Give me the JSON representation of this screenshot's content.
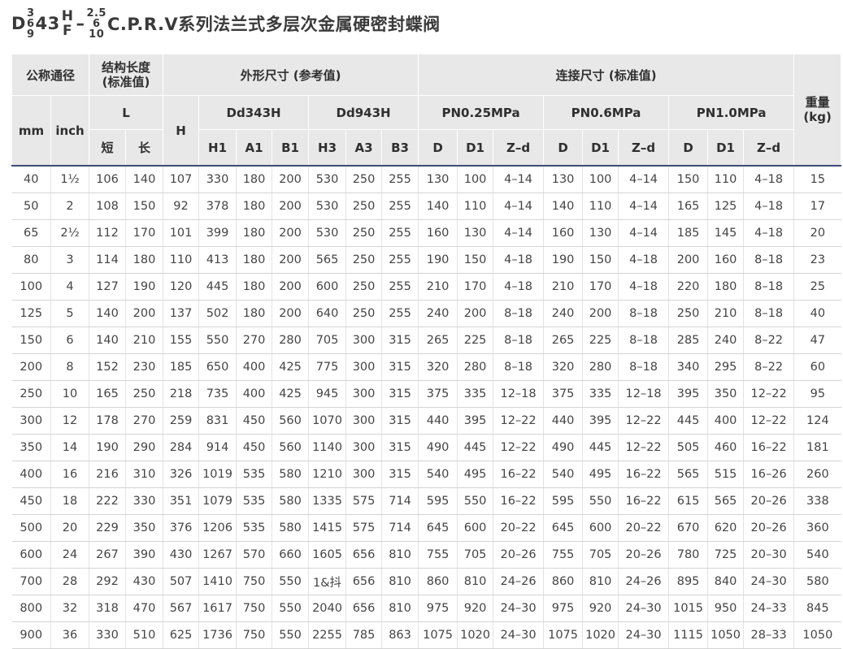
{
  "title": {
    "prefix": "D",
    "frac_top": "3",
    "frac_mid": "6",
    "frac_bot": "9",
    "mid_text": "43",
    "hf_top": "H",
    "hf_bot": "F",
    "dash": "–",
    "p_top": "2.5",
    "p_mid": "6",
    "p_bot": "10",
    "suffix": "C.P.R.V系列法兰式多层次金属硬密封蝶阀"
  },
  "headers": {
    "nominal": "公称通径",
    "structure_length": "结构长度\n(标准值)",
    "outline": "外形尺寸 (参考值)",
    "connection": "连接尺寸 (标准值)",
    "weight": "重量\n(kg)",
    "mm": "mm",
    "inch": "inch",
    "L": "L",
    "H": "H",
    "dd343h": "Dd343H",
    "dd943h": "Dd943H",
    "pn025": "PN0.25MPa",
    "pn06": "PN0.6MPa",
    "pn10": "PN1.0MPa",
    "short": "短",
    "long": "长",
    "H1": "H1",
    "A1": "A1",
    "B1": "B1",
    "H3": "H3",
    "A3": "A3",
    "B3": "B3",
    "D": "D",
    "D1": "D1",
    "Zd": "Z–d"
  },
  "rows": [
    [
      "40",
      "1½",
      "106",
      "140",
      "107",
      "330",
      "180",
      "200",
      "530",
      "250",
      "255",
      "130",
      "100",
      "4–14",
      "130",
      "100",
      "4–14",
      "150",
      "110",
      "4–18",
      "15"
    ],
    [
      "50",
      "2",
      "108",
      "150",
      "92",
      "378",
      "180",
      "200",
      "530",
      "250",
      "255",
      "140",
      "110",
      "4–14",
      "140",
      "110",
      "4–14",
      "165",
      "125",
      "4–18",
      "17"
    ],
    [
      "65",
      "2½",
      "112",
      "170",
      "101",
      "399",
      "180",
      "200",
      "530",
      "250",
      "255",
      "160",
      "130",
      "4–14",
      "160",
      "130",
      "4–14",
      "185",
      "145",
      "4–18",
      "20"
    ],
    [
      "80",
      "3",
      "114",
      "180",
      "110",
      "413",
      "180",
      "200",
      "565",
      "250",
      "255",
      "190",
      "150",
      "4–18",
      "190",
      "150",
      "4–18",
      "200",
      "160",
      "8–18",
      "23"
    ],
    [
      "100",
      "4",
      "127",
      "190",
      "120",
      "445",
      "180",
      "200",
      "600",
      "250",
      "255",
      "210",
      "170",
      "4–18",
      "210",
      "170",
      "4–18",
      "220",
      "180",
      "8–18",
      "25"
    ],
    [
      "125",
      "5",
      "140",
      "200",
      "137",
      "502",
      "180",
      "200",
      "640",
      "250",
      "255",
      "240",
      "200",
      "8–18",
      "240",
      "200",
      "8–18",
      "250",
      "210",
      "8–18",
      "40"
    ],
    [
      "150",
      "6",
      "140",
      "210",
      "155",
      "550",
      "270",
      "280",
      "705",
      "300",
      "315",
      "265",
      "225",
      "8–18",
      "265",
      "225",
      "8–18",
      "285",
      "240",
      "8–22",
      "47"
    ],
    [
      "200",
      "8",
      "152",
      "230",
      "185",
      "650",
      "400",
      "425",
      "775",
      "300",
      "315",
      "320",
      "280",
      "8–18",
      "320",
      "280",
      "8–18",
      "340",
      "295",
      "8–22",
      "60"
    ],
    [
      "250",
      "10",
      "165",
      "250",
      "218",
      "735",
      "400",
      "425",
      "945",
      "300",
      "315",
      "375",
      "335",
      "12–18",
      "375",
      "335",
      "12–18",
      "395",
      "350",
      "12–22",
      "95"
    ],
    [
      "300",
      "12",
      "178",
      "270",
      "259",
      "831",
      "450",
      "560",
      "1070",
      "300",
      "315",
      "440",
      "395",
      "12–22",
      "440",
      "395",
      "12–22",
      "445",
      "400",
      "12–22",
      "124"
    ],
    [
      "350",
      "14",
      "190",
      "290",
      "284",
      "914",
      "450",
      "560",
      "1140",
      "300",
      "315",
      "490",
      "445",
      "12–22",
      "490",
      "445",
      "12–22",
      "505",
      "460",
      "16–22",
      "181"
    ],
    [
      "400",
      "16",
      "216",
      "310",
      "326",
      "1019",
      "535",
      "580",
      "1210",
      "300",
      "315",
      "540",
      "495",
      "16–22",
      "540",
      "495",
      "16–22",
      "565",
      "515",
      "16–26",
      "260"
    ],
    [
      "450",
      "18",
      "222",
      "330",
      "351",
      "1079",
      "535",
      "580",
      "1335",
      "575",
      "714",
      "595",
      "550",
      "16–22",
      "595",
      "550",
      "16–22",
      "615",
      "565",
      "20–26",
      "338"
    ],
    [
      "500",
      "20",
      "229",
      "350",
      "376",
      "1206",
      "535",
      "580",
      "1415",
      "575",
      "714",
      "645",
      "600",
      "20–22",
      "645",
      "600",
      "20–22",
      "670",
      "620",
      "20–26",
      "360"
    ],
    [
      "600",
      "24",
      "267",
      "390",
      "430",
      "1267",
      "570",
      "660",
      "1605",
      "656",
      "810",
      "755",
      "705",
      "20–26",
      "755",
      "705",
      "20–26",
      "780",
      "725",
      "20–30",
      "540"
    ],
    [
      "700",
      "28",
      "292",
      "430",
      "507",
      "1410",
      "750",
      "550",
      "1&抖",
      "656",
      "810",
      "860",
      "810",
      "24–26",
      "860",
      "810",
      "24–26",
      "895",
      "840",
      "24–30",
      "580"
    ],
    [
      "800",
      "32",
      "318",
      "470",
      "567",
      "1617",
      "750",
      "550",
      "2040",
      "656",
      "810",
      "975",
      "920",
      "24–30",
      "975",
      "920",
      "24–30",
      "1015",
      "950",
      "24–33",
      "845"
    ],
    [
      "900",
      "36",
      "330",
      "510",
      "625",
      "1736",
      "750",
      "550",
      "2255",
      "785",
      "863",
      "1075",
      "1020",
      "24–30",
      "1075",
      "1020",
      "24–30",
      "1115",
      "1050",
      "28–33",
      "1050"
    ]
  ]
}
